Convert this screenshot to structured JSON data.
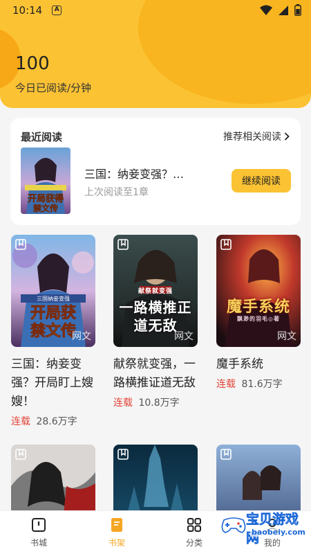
{
  "status_bar": {
    "time": "10:14",
    "notification_icon": "A"
  },
  "header": {
    "reading_minutes": "100",
    "reading_label": "今日已阅读/分钟"
  },
  "recent": {
    "title": "最近阅读",
    "recommend": "推荐相关阅读",
    "book_title": "三国：纳妾变强？…",
    "progress": "上次阅读至1章",
    "continue": "继续阅读"
  },
  "books": [
    {
      "title": "三国：纳妾变强？开局盯上嫂嫂！",
      "status": "连载",
      "words": "28.6万字",
      "cover_text": "开局获得禁文传",
      "watermark": "网文"
    },
    {
      "title": "献祭就变强，一路横推证道无敌",
      "status": "连载",
      "words": "10.8万字",
      "cover_text": "一路横推正道无敌",
      "cover_sub": "献祭就变强",
      "watermark": "网文"
    },
    {
      "title": "魔手系统",
      "status": "连载",
      "words": "81.6万字",
      "cover_text": "魔手系统",
      "cover_sub": "飘渺的羽毛◎著",
      "watermark": "网文"
    }
  ],
  "nav": {
    "items": [
      {
        "label": "书城",
        "icon": "bookstore-icon"
      },
      {
        "label": "书架",
        "icon": "bookshelf-icon"
      },
      {
        "label": "分类",
        "icon": "category-icon"
      },
      {
        "label": "我的",
        "icon": "profile-icon"
      }
    ]
  },
  "site_watermark": {
    "text": "宝贝游戏网",
    "url": "baobeiy.com"
  },
  "colors": {
    "accent": "#fbc233",
    "status_red": "#e2453a",
    "active_nav": "#f5a623"
  }
}
